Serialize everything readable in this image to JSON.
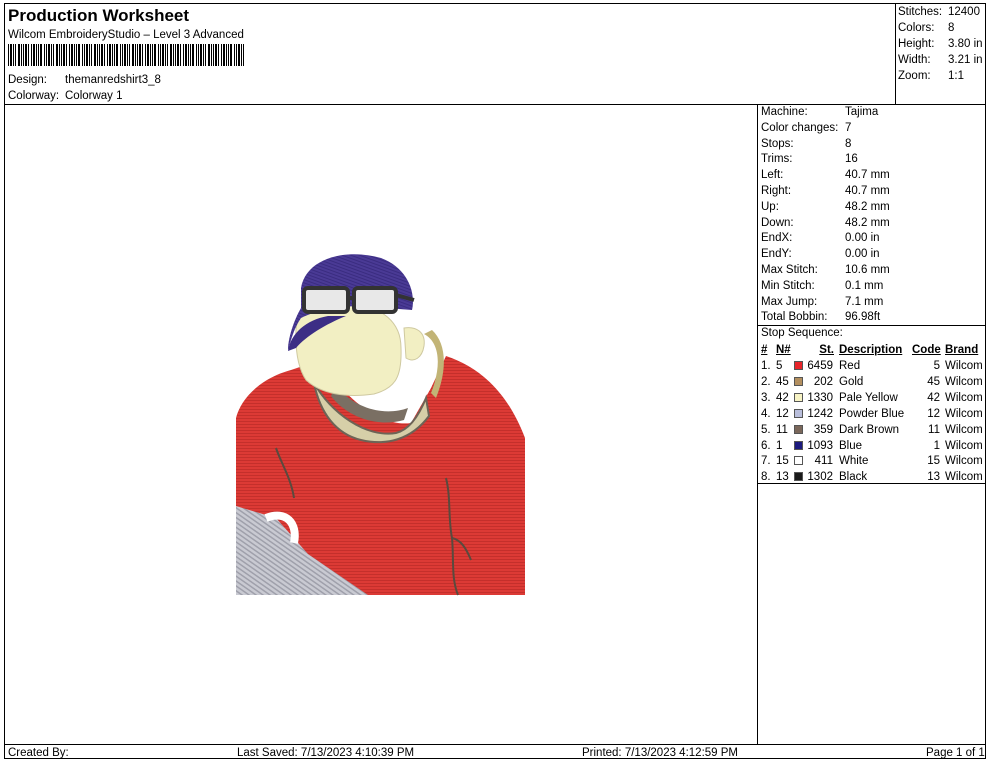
{
  "header": {
    "title": "Production Worksheet",
    "subtitle": "Wilcom EmbroideryStudio – Level 3 Advanced",
    "design_label": "Design:",
    "design_value": "themanredshirt3_8",
    "colorway_label": "Colorway:",
    "colorway_value": "Colorway 1"
  },
  "summary": [
    {
      "label": "Stitches:",
      "value": "12400"
    },
    {
      "label": "Colors:",
      "value": "8"
    },
    {
      "label": "Height:",
      "value": "3.80 in"
    },
    {
      "label": "Width:",
      "value": "3.21 in"
    },
    {
      "label": "Zoom:",
      "value": "1:1"
    }
  ],
  "machine_info": [
    {
      "label": "Machine:",
      "value": "Tajima"
    },
    {
      "label": "Color changes:",
      "value": "7"
    },
    {
      "label": "Stops:",
      "value": "8"
    },
    {
      "label": "Trims:",
      "value": "16"
    },
    {
      "label": "Left:",
      "value": "40.7 mm"
    },
    {
      "label": "Right:",
      "value": "40.7 mm"
    },
    {
      "label": "Up:",
      "value": "48.2 mm"
    },
    {
      "label": "Down:",
      "value": "48.2 mm"
    },
    {
      "label": "EndX:",
      "value": "0.00 in"
    },
    {
      "label": "EndY:",
      "value": "0.00 in"
    },
    {
      "label": "Max Stitch:",
      "value": "10.6 mm"
    },
    {
      "label": "Min Stitch:",
      "value": "0.1 mm"
    },
    {
      "label": "Max Jump:",
      "value": "7.1 mm"
    },
    {
      "label": "Total Bobbin:",
      "value": "96.98ft"
    }
  ],
  "stop_sequence": {
    "title": "Stop Sequence:",
    "headers": {
      "num": "#",
      "n": "N#",
      "st": "St.",
      "desc": "Description",
      "code": "Code",
      "brand": "Brand"
    },
    "rows": [
      {
        "num": "1.",
        "n": "5",
        "color": "#e8242a",
        "st": "6459",
        "desc": "Red",
        "code": "5",
        "brand": "Wilcom"
      },
      {
        "num": "2.",
        "n": "45",
        "color": "#b38f5f",
        "st": "202",
        "desc": "Gold",
        "code": "45",
        "brand": "Wilcom"
      },
      {
        "num": "3.",
        "n": "42",
        "color": "#f7f3c4",
        "st": "1330",
        "desc": "Pale Yellow",
        "code": "42",
        "brand": "Wilcom"
      },
      {
        "num": "4.",
        "n": "12",
        "color": "#b9bedb",
        "st": "1242",
        "desc": "Powder Blue",
        "code": "12",
        "brand": "Wilcom"
      },
      {
        "num": "5.",
        "n": "11",
        "color": "#7a675a",
        "st": "359",
        "desc": "Dark Brown",
        "code": "11",
        "brand": "Wilcom"
      },
      {
        "num": "6.",
        "n": "1",
        "color": "#1c1a7e",
        "st": "1093",
        "desc": "Blue",
        "code": "1",
        "brand": "Wilcom"
      },
      {
        "num": "7.",
        "n": "15",
        "color": "#ffffff",
        "st": "411",
        "desc": "White",
        "code": "15",
        "brand": "Wilcom"
      },
      {
        "num": "8.",
        "n": "13",
        "color": "#1a1a1a",
        "st": "1302",
        "desc": "Black",
        "code": "13",
        "brand": "Wilcom"
      }
    ]
  },
  "footer": {
    "created_by": "Created By:",
    "last_saved": "Last Saved: 7/13/2023 4:10:39 PM",
    "printed": "Printed: 7/13/2023 4:12:59 PM",
    "page": "Page 1 of 1"
  }
}
